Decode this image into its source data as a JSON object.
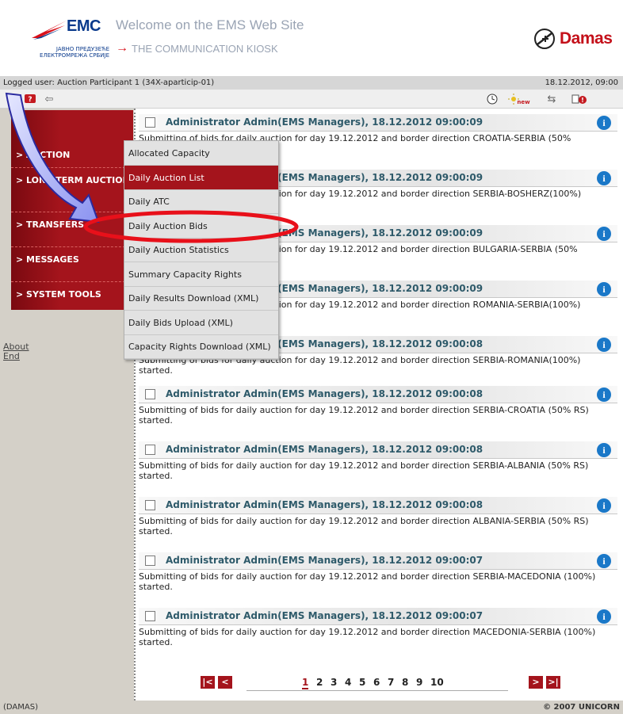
{
  "header": {
    "logo_emc": "EMC",
    "logo_sub_line1": "ЈАВНО ПРЕДУЗЕЋЕ",
    "logo_sub_line2": "ЕЛЕКТРОМРЕЖА СРБИЈЕ",
    "welcome": "Welcome on the EMS Web Site",
    "kiosk": "THE COMMUNICATION KIOSK",
    "damas": "Damas"
  },
  "userbar": {
    "logged_user": "Logged user: Auction Participant 1 (34X-aparticip-01)",
    "datetime": "18.12.2012, 09:00"
  },
  "toolbar": {
    "new_badge": "new"
  },
  "sidebar": {
    "items": [
      {
        "label": "> AUCTION"
      },
      {
        "label": "> LONG-TERM AUCTION"
      },
      {
        "label": "> TRANSFERS"
      },
      {
        "label": "> MESSAGES"
      },
      {
        "label": "> SYSTEM TOOLS"
      }
    ],
    "about": "About",
    "end": "End"
  },
  "dropdown": {
    "items": [
      {
        "label": "Allocated Capacity"
      },
      {
        "label": "Daily Auction List"
      },
      {
        "label": "Daily ATC"
      },
      {
        "label": "Daily Auction Bids"
      },
      {
        "label": "Daily Auction Statistics"
      },
      {
        "label": "Summary Capacity Rights"
      },
      {
        "label": "Daily Results Download (XML)"
      },
      {
        "label": "Daily Bids Upload (XML)"
      },
      {
        "label": "Capacity Rights Download (XML)"
      }
    ]
  },
  "messages": [
    {
      "title": "Administrator Admin(EMS Managers), 18.12.2012 09:00:09",
      "body": "Submitting of bids for daily auction for day 19.12.2012 and border direction CROATIA-SERBIA (50%"
    },
    {
      "title": "Administrator Admin(EMS Managers), 18.12.2012 09:00:09",
      "body": "Submitting of bids for daily auction for day 19.12.2012 and border direction SERBIA-BOSHERZ(100%)"
    },
    {
      "title": "Administrator Admin(EMS Managers), 18.12.2012 09:00:09",
      "body": "Submitting of bids for daily auction for day 19.12.2012 and border direction BULGARIA-SERBIA (50%"
    },
    {
      "title": "Administrator Admin(EMS Managers), 18.12.2012 09:00:09",
      "body": "Submitting of bids for daily auction for day 19.12.2012 and border direction ROMANIA-SERBIA(100%)"
    },
    {
      "title": "Administrator Admin(EMS Managers), 18.12.2012 09:00:08",
      "body": "Submitting of bids for daily auction for day 19.12.2012 and border direction SERBIA-ROMANIA(100%) started."
    },
    {
      "title": "Administrator Admin(EMS Managers), 18.12.2012 09:00:08",
      "body": "Submitting of bids for daily auction for day 19.12.2012 and border direction SERBIA-CROATIA (50% RS) started."
    },
    {
      "title": "Administrator Admin(EMS Managers), 18.12.2012 09:00:08",
      "body": "Submitting of bids for daily auction for day 19.12.2012 and border direction SERBIA-ALBANIA (50% RS) started."
    },
    {
      "title": "Administrator Admin(EMS Managers), 18.12.2012 09:00:08",
      "body": "Submitting of bids for daily auction for day 19.12.2012 and border direction ALBANIA-SERBIA (50% RS) started."
    },
    {
      "title": "Administrator Admin(EMS Managers), 18.12.2012 09:00:07",
      "body": "Submitting of bids for daily auction for day 19.12.2012 and border direction SERBIA-MACEDONIA (100%) started."
    },
    {
      "title": "Administrator Admin(EMS Managers), 18.12.2012 09:00:07",
      "body": "Submitting of bids for daily auction for day 19.12.2012 and border direction MACEDONIA-SERBIA (100%) started."
    }
  ],
  "pager": {
    "first": "|<",
    "prev": "<",
    "next": ">",
    "last": ">|",
    "pages": [
      "1",
      "2",
      "3",
      "4",
      "5",
      "6",
      "7",
      "8",
      "9",
      "10"
    ]
  },
  "status": {
    "left": "(DAMAS)",
    "right": "© 2007 UNICORN"
  }
}
